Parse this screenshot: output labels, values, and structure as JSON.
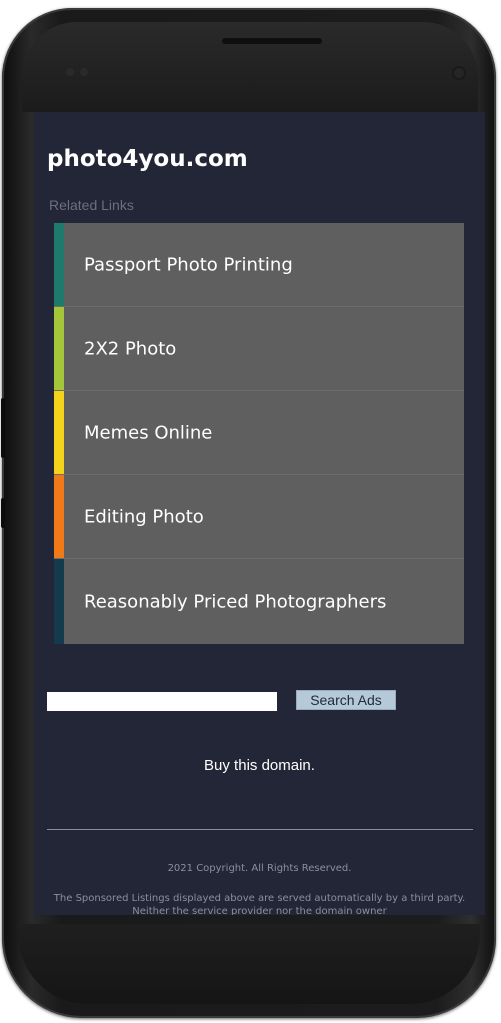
{
  "site": {
    "title": "photo4you.com",
    "related_label": "Related Links"
  },
  "links": [
    {
      "label": "Passport Photo Printing",
      "color": "#1e7a6a"
    },
    {
      "label": "2X2 Photo",
      "color": "#a5c63b"
    },
    {
      "label": "Memes Online",
      "color": "#f5d31a"
    },
    {
      "label": "Editing Photo",
      "color": "#f07a17"
    },
    {
      "label": "Reasonably Priced Photographers",
      "color": "#143a4e"
    }
  ],
  "search": {
    "value": "",
    "button_label": "Search Ads"
  },
  "footer": {
    "buy_domain": "Buy this domain.",
    "copyright": "2021 Copyright. All Rights Reserved.",
    "disclaimer": "The Sponsored Listings displayed above are served automatically by a third party. Neither the service provider nor the domain owner"
  },
  "colors": {
    "screen_bg": "#232637",
    "link_bg": "#5f5f5f",
    "button_bg": "#b6c9d8"
  }
}
